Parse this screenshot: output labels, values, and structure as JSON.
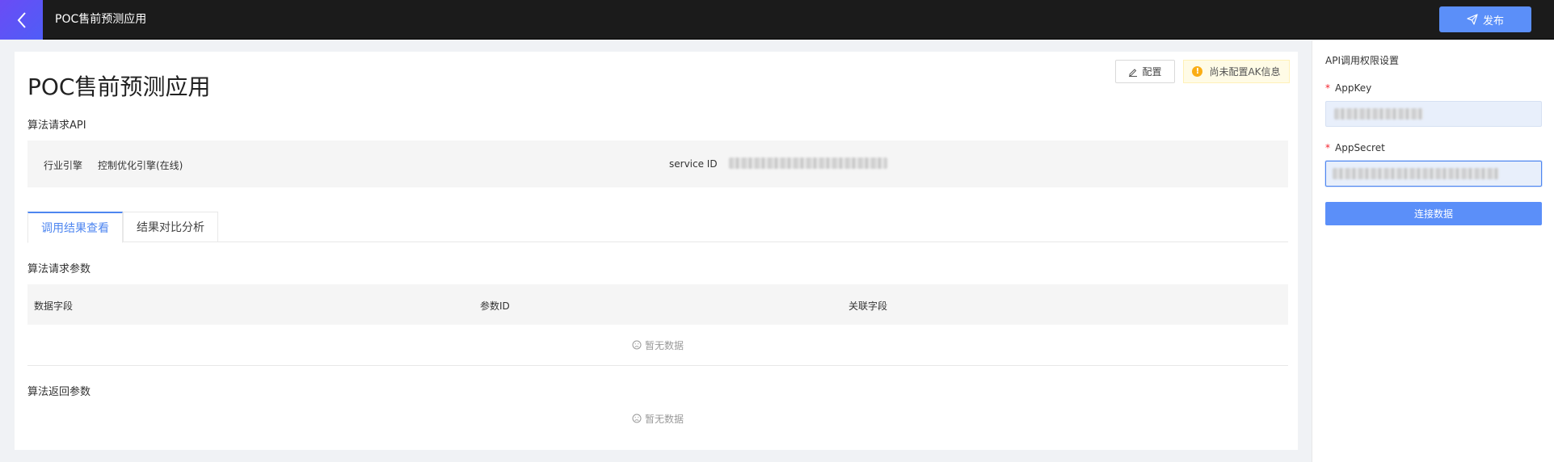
{
  "header": {
    "app_title": "POC售前预测应用",
    "publish_label": "发布"
  },
  "main": {
    "page_title": "POC售前预测应用",
    "config_label": "配置",
    "ak_warning": "尚未配置AK信息",
    "api_section_label": "算法请求API",
    "industry_engine_label": "行业引擎",
    "industry_engine_value": "控制优化引擎(在线)",
    "service_id_label": "service ID",
    "tabs": [
      {
        "label": "调用结果查看",
        "active": true
      },
      {
        "label": "结果对比分析",
        "active": false
      }
    ],
    "request_params_label": "算法请求参数",
    "table_columns": [
      "数据字段",
      "参数ID",
      "关联字段"
    ],
    "empty_text": "暂无数据",
    "return_params_label": "算法返回参数",
    "return_empty_text": "暂无数据"
  },
  "sidebar": {
    "title": "API调用权限设置",
    "appkey_label": "AppKey",
    "appsecret_label": "AppSecret",
    "connect_label": "连接数据"
  },
  "colors": {
    "accent": "#5b8ff9",
    "tab_active": "#4e86f0",
    "topbar": "#1b1b1b",
    "back_button": "#5b54f6",
    "warning": "#faad14",
    "required": "#f5222d"
  },
  "icons": {
    "back": "chevron-left-icon",
    "publish": "send-icon",
    "config": "edit-icon",
    "warning": "exclamation-circle-icon",
    "empty": "frown-icon"
  }
}
